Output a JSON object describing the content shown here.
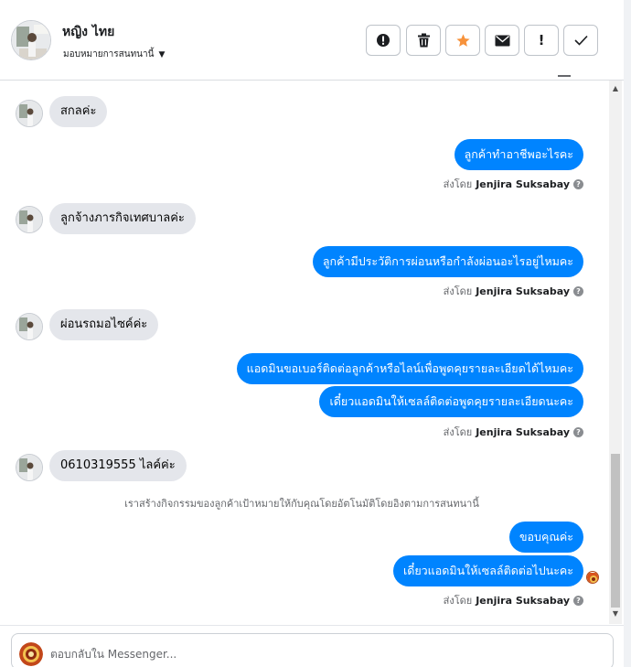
{
  "header": {
    "contact_name": "หญิง ไทย",
    "assign_label": "มอบหมายการสนทนานี้",
    "actions": [
      {
        "name": "mark-spam-button",
        "icon": "alert-circle-icon",
        "glyph": "!"
      },
      {
        "name": "delete-button",
        "icon": "trash-icon",
        "glyph": "🗑"
      },
      {
        "name": "star-button",
        "icon": "star-icon",
        "glyph": "★"
      },
      {
        "name": "mark-unread-button",
        "icon": "envelope-icon",
        "glyph": "✉"
      },
      {
        "name": "follow-up-button",
        "icon": "exclamation-icon",
        "glyph": "!"
      },
      {
        "name": "mark-done-button",
        "icon": "check-icon",
        "glyph": "✓"
      }
    ]
  },
  "conversation": {
    "sent_by_prefix": "ส่งโดย",
    "agent_name": "Jenjira Suksabay",
    "messages": [
      {
        "direction": "in",
        "text": "สกลค่ะ"
      },
      {
        "direction": "out",
        "text": "ลูกค้าทำอาชีพอะไรคะ"
      },
      {
        "direction": "in",
        "text": "ลูกจ้างภารกิจเทศบาลค่ะ"
      },
      {
        "direction": "out",
        "text": "ลูกค้ามีประวัติการผ่อนหรือกำลังผ่อนอะไรอยู่ไหมคะ"
      },
      {
        "direction": "in",
        "text": "ผ่อนรถมอไซค์ค่ะ"
      },
      {
        "direction": "out",
        "text": "แอดมินขอเบอร์ติดต่อลูกค้าหรือไลน์เพื่อพูดคุยรายละเอียดได้ไหมคะ"
      },
      {
        "direction": "out",
        "text": "เดี๋ยวแอดมินให้เซลล์ติดต่อพูดคุยรายละเอียดนะคะ"
      },
      {
        "direction": "in",
        "text": "0610319555 ไลค์ค่ะ"
      },
      {
        "direction": "out",
        "text": "ขอบคุณค่ะ"
      },
      {
        "direction": "out",
        "text": "เดี๋ยวแอดมินให้เซลล์ติดต่อไปนะคะ"
      }
    ],
    "system_notice": "เราสร้างกิจกรรมของลูกค้าเป้าหมายให้กับคุณโดยอัตโนมัติโดยอิงตามการสนทนานี้"
  },
  "composer": {
    "placeholder": "ตอบกลับใน Messenger..."
  },
  "colors": {
    "outgoing_bubble": "#0084ff",
    "incoming_bubble": "#e4e6eb",
    "star": "#f7923b"
  }
}
